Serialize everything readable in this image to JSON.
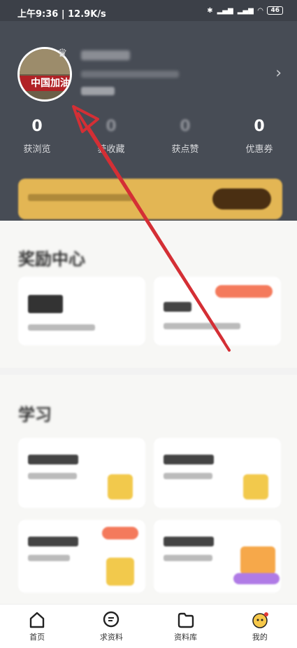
{
  "statusbar": {
    "time": "上午9:36 | 12.9K/s",
    "battery": "46"
  },
  "profile": {
    "avatar_text": "中国加油"
  },
  "stats": [
    {
      "value": "0",
      "label": "获浏览"
    },
    {
      "value": "0",
      "label": "获收藏"
    },
    {
      "value": "0",
      "label": "获点赞"
    },
    {
      "value": "0",
      "label": "优惠券"
    }
  ],
  "sections": {
    "rewards_title": "奖励中心",
    "study_title": "学习"
  },
  "nav": {
    "items": [
      {
        "label": "首页",
        "icon": "home-icon"
      },
      {
        "label": "求资料",
        "icon": "chat-icon"
      },
      {
        "label": "资料库",
        "icon": "folder-icon"
      },
      {
        "label": "我的",
        "icon": "avatar-icon"
      }
    ]
  },
  "colors": {
    "header_bg": "#474c55",
    "accent_red": "#d42f35",
    "vip_gold": "#e3b654"
  }
}
